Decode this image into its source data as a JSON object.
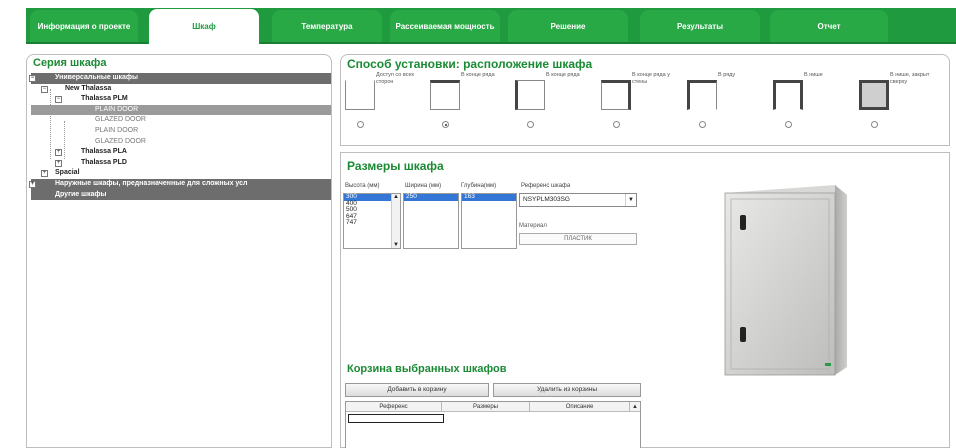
{
  "tabs": [
    {
      "label": "Информация о проекте",
      "active": false
    },
    {
      "label": "Шкаф",
      "active": true
    },
    {
      "label": "Температура",
      "active": false
    },
    {
      "label": "Рассеиваемая мощность",
      "active": false
    },
    {
      "label": "Решение",
      "active": false
    },
    {
      "label": "Результаты",
      "active": false
    },
    {
      "label": "Отчет",
      "active": false
    }
  ],
  "series": {
    "title": "Серия шкафа",
    "tree": {
      "universal": "Универсальные шкафы",
      "new_thalassa": "New Thalassa",
      "thalassa_plm": "Thalassa PLM",
      "plain_door_1": "PLAIN DOOR",
      "glazed_door_1": "GLAZED DOOR",
      "plain_door_2": "PLAIN DOOR",
      "glazed_door_2": "GLAZED DOOR",
      "thalassa_pla": "Thalassa PLA",
      "thalassa_pld": "Thalassa PLD",
      "spacial": "Spacial",
      "outdoor": "Наружные шкафы, предназначенные для сложных усл",
      "other": "Другие шкафы"
    }
  },
  "mounting": {
    "title": "Способ установки: расположение шкафа",
    "options": [
      {
        "label": "Доступ со всех сторон",
        "selected": false
      },
      {
        "label": "В конце ряда",
        "selected": true
      },
      {
        "label": "В конце ряда",
        "selected": false
      },
      {
        "label": "В конце ряда у стены",
        "selected": false
      },
      {
        "label": "В ряду",
        "selected": false
      },
      {
        "label": "В нише",
        "selected": false
      },
      {
        "label": "В нише, закрыт сверху",
        "selected": false
      }
    ]
  },
  "sizes": {
    "title": "Размеры шкафа",
    "height_label": "Высота (мм)",
    "width_label": "Ширина (мм)",
    "depth_label": "Глубина(мм)",
    "reference_label": "Референс шкафа",
    "heights": [
      "300",
      "400",
      "500",
      "647",
      "747"
    ],
    "widths": [
      "250"
    ],
    "depths": [
      "163"
    ],
    "reference_value": "NSYPLM303SG",
    "material_label": "Материал",
    "material_value": "ПЛАСТИК"
  },
  "basket": {
    "title": "Корзина выбранных шкафов",
    "add_button": "Добавить в корзину",
    "remove_button": "Удалить из корзины",
    "col_reference": "Референс",
    "col_sizes": "Размеры",
    "col_description": "Описание"
  },
  "colors": {
    "brand_green": "#1f9a3e",
    "title_green": "#1a8a34",
    "selection_blue": "#3476d6"
  }
}
